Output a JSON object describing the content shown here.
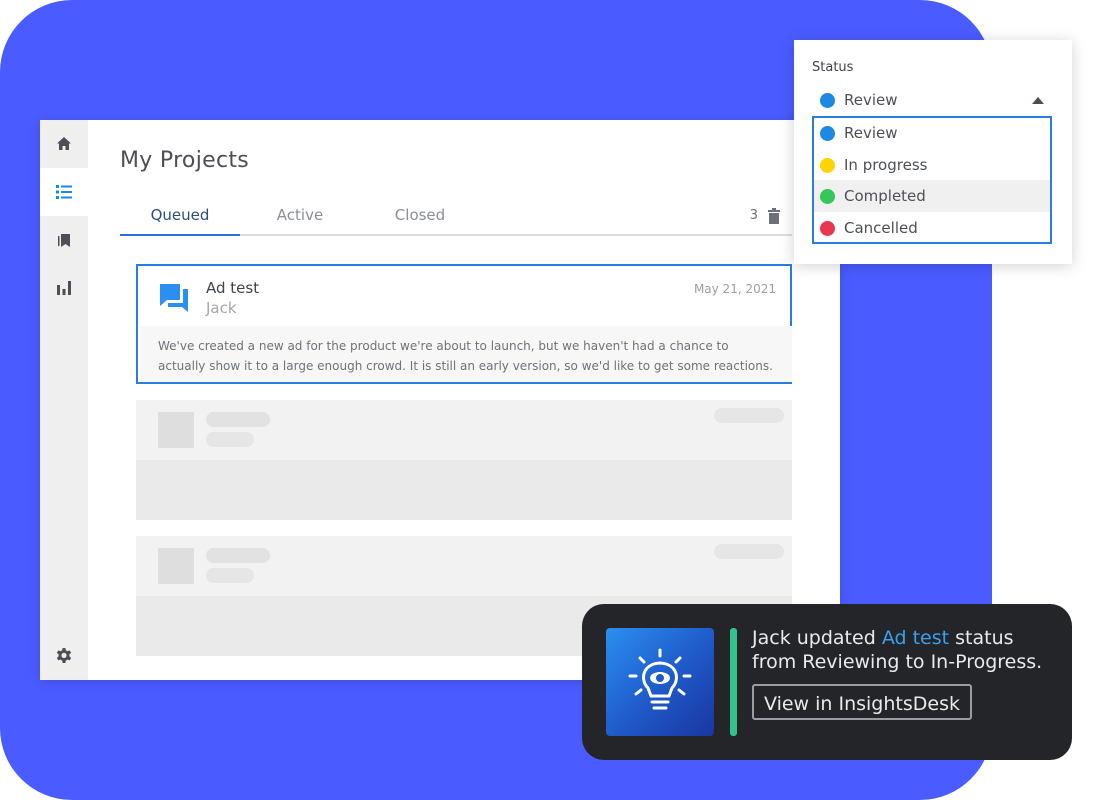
{
  "app": {
    "title": "My Projects",
    "sidebar": {
      "items": [
        {
          "icon": "home-icon"
        },
        {
          "icon": "list-icon",
          "active": true
        },
        {
          "icon": "bookmarks-icon"
        },
        {
          "icon": "bar-chart-icon"
        },
        {
          "icon": "settings-icon"
        }
      ]
    },
    "tabs": [
      {
        "label": "Queued",
        "active": true
      },
      {
        "label": "Active"
      },
      {
        "label": "Closed"
      }
    ],
    "count": "3",
    "project": {
      "name": "Ad test",
      "author": "Jack",
      "date": "May 21, 2021",
      "description": "We've created a new ad for the product we're about to launch, but we haven't had a chance to actually show it to a large enough crowd. It is still an early version, so we'd like to get some reactions."
    }
  },
  "status_dropdown": {
    "label": "Status",
    "selected": "Review",
    "options": [
      {
        "label": "Review",
        "color": "#1e88e5"
      },
      {
        "label": "In progress",
        "color": "#ffd400"
      },
      {
        "label": "Completed",
        "color": "#35c759"
      },
      {
        "label": "Cancelled",
        "color": "#e8384f"
      }
    ]
  },
  "notification": {
    "actor": "Jack",
    "verb": "updated",
    "project_link": "Ad test",
    "message_rest": "status from Reviewing to In-Progress.",
    "button_label": "View in InsightsDesk",
    "accent_color": "#33c48e",
    "icon": "lightbulb-icon"
  },
  "colors": {
    "background_accent": "#4a5cff",
    "primary": "#2a7de1"
  }
}
